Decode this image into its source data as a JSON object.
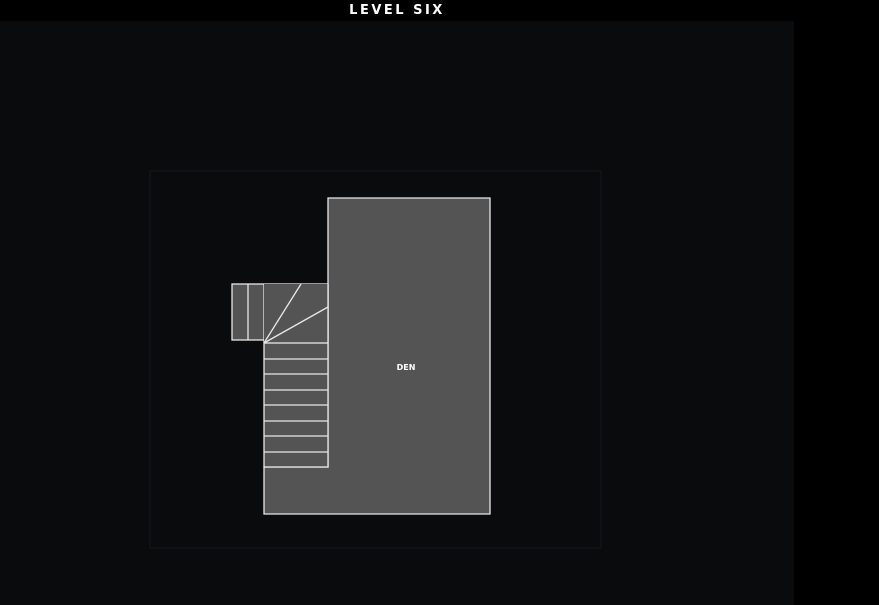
{
  "header": {
    "title": "LEVEL SIX"
  },
  "floorplan": {
    "rooms": [
      {
        "label": "DEN"
      }
    ]
  },
  "colors": {
    "background": "#0a0b0d",
    "header": "#000000",
    "room_fill": "#545454",
    "line": "#e8e8e8"
  }
}
